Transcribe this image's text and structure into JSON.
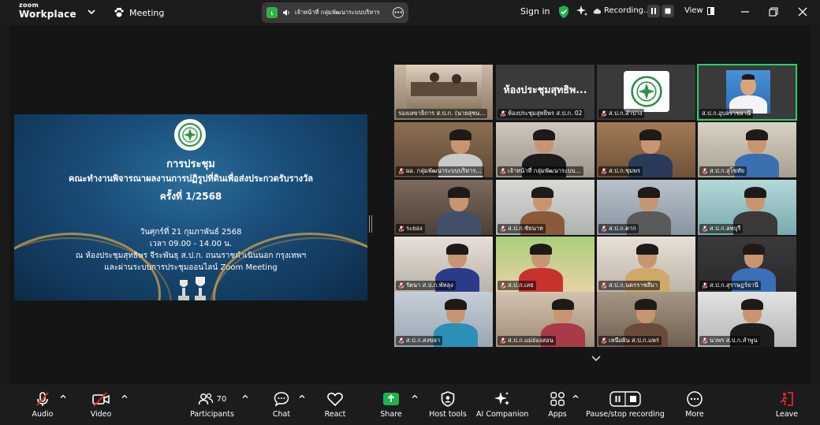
{
  "app": {
    "logo_top": "zoom",
    "logo_bottom": "Workplace",
    "meeting_label": "Meeting"
  },
  "talker": {
    "avatar_letter": "เ",
    "name": "เจ้าหน้าที่ กลุ่มพัฒนาระบบบริหาร"
  },
  "top_right": {
    "sign_in": "Sign in",
    "recording": "Recording...",
    "view": "View"
  },
  "colors": {
    "accent_green": "#25d366",
    "rec_red": "#e02828",
    "share_blue": "#1a4d78",
    "gold": "#d9a84a"
  },
  "shared_screen": {
    "title": "การประชุม",
    "subtitle": "คณะทำงานพิจารณาผลงานการปฏิรูปที่ดินเพื่อส่งประกวดรับรางวัล",
    "session": "ครั้งที่ 1/2568",
    "date": "วันศุกร์ที่ 21 กุมภาพันธ์ 2568",
    "time": "เวลา 09.00 - 14.00 น.",
    "place": "ณ ห้องประชุมสุทธิพร จีระพันธุ ส.ป.ก. ถนนราชดำเนินนอก กรุงเทพฯ",
    "online": "และผ่านระบบการประชุมออนไลน์ Zoom Meeting"
  },
  "gallery": {
    "featured_room_name": "ห้องประชุมสุทธิพ...",
    "tiles": [
      {
        "name": "รองเลขาธิการ ส.ป.ก. (นายสุชน...",
        "muted": false
      },
      {
        "name": "ห้องประชุมสุทธิพร ส.ป.ก. 02",
        "muted": true
      },
      {
        "name": "ส.ป.ก.ลำปาง",
        "muted": true
      },
      {
        "name": "ส.ป.ก.อุบลราชธานี",
        "muted": false
      },
      {
        "name": "ผอ. กลุ่มพัฒนาระบบบริหาร...",
        "muted": true
      },
      {
        "name": "เจ้าหน้าที่ กลุ่มพัฒนาระบบ...",
        "muted": true
      },
      {
        "name": "ส.ป.ก.ชุมพร",
        "muted": true
      },
      {
        "name": "ส.ป.ก.สุโขทัย",
        "muted": true
      },
      {
        "name": "ระยอง",
        "muted": true
      },
      {
        "name": "ส.ป.ก.ชัยนาท",
        "muted": true
      },
      {
        "name": "ส.ป.ก.ตาก",
        "muted": true
      },
      {
        "name": "ส.ป.ก.ลพบุรี",
        "muted": true
      },
      {
        "name": "รัตนา ส.ป.ก.พัทลุง",
        "muted": true
      },
      {
        "name": "ส.ป.ก.เลย",
        "muted": true
      },
      {
        "name": "ส.ป.ก.นครราชสีมา",
        "muted": true
      },
      {
        "name": "ส.ป.ก.สุราษฎร์ธานี",
        "muted": true
      },
      {
        "name": "ส.ป.ก.สงขลา",
        "muted": true
      },
      {
        "name": "ส.ป.ก.แม่ฮ่องสอน",
        "muted": true
      },
      {
        "name": "เหนือฝัน ส.ป.ก.แพร่",
        "muted": true
      },
      {
        "name": "นวพร ส.ป.ก.ลำพูน",
        "muted": true
      }
    ]
  },
  "toolbar": {
    "audio": "Audio",
    "video": "Video",
    "participants": "Participants",
    "participants_count": "70",
    "chat": "Chat",
    "react": "React",
    "share": "Share",
    "host_tools": "Host tools",
    "ai_companion": "AI Companion",
    "apps": "Apps",
    "pause_stop": "Pause/stop recording",
    "more": "More",
    "leave": "Leave"
  }
}
